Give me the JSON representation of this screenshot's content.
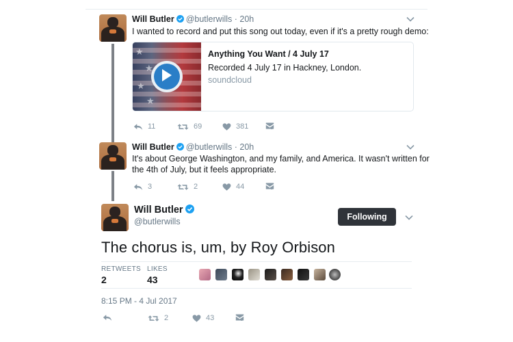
{
  "tweets": [
    {
      "name": "Will Butler",
      "handle": "@butlerwills",
      "time": "· 20h",
      "text": "I wanted to record and put this song out today, even if it's a pretty rough demo:",
      "card": {
        "title": "Anything You Want / 4 July 17",
        "description": "Recorded 4 July 17 in Hackney, London.",
        "domain": "soundcloud"
      },
      "replies": "11",
      "retweets": "69",
      "likes": "381"
    },
    {
      "name": "Will Butler",
      "handle": "@butlerwills",
      "time": "· 20h",
      "text_line1": "It's about George Washington, and my family, and America. It wasn't written for",
      "text_line2": "the 4th of July, but it feels appropriate.",
      "replies": "3",
      "retweets": "2",
      "likes": "44"
    }
  ],
  "main": {
    "name": "Will Butler",
    "handle": "@butlerwills",
    "follow_label": "Following",
    "text": "The chorus is, um, by Roy Orbison",
    "retweets_label": "RETWEETS",
    "retweets_count": "2",
    "likes_label": "LIKES",
    "likes_count": "43",
    "timestamp": "8:15 PM - 4 Jul 2017",
    "action_retweets": "2",
    "action_likes": "43"
  },
  "colors": {
    "verified": "#1da1f2",
    "follow_button": "#2f3339",
    "soundcloud_play": "#2a7ec7",
    "action_icon": "#8899a6"
  },
  "icons": {
    "reply": "reply-icon",
    "retweet": "retweet-icon",
    "like": "heart-icon",
    "dm": "envelope-icon",
    "more": "chevron-down-icon",
    "verified": "verified-badge-icon"
  }
}
